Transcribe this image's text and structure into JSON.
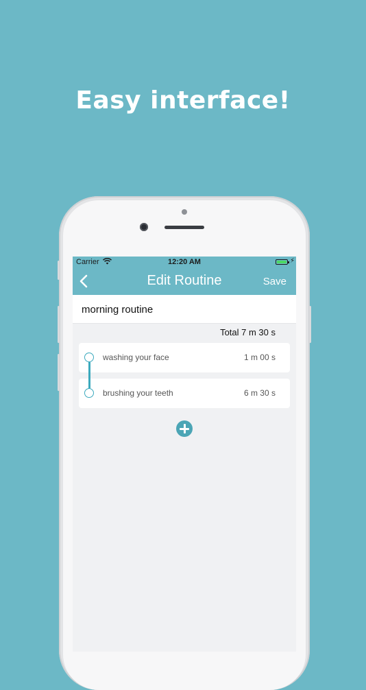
{
  "promo": {
    "headline": "Easy interface!"
  },
  "status_bar": {
    "carrier": "Carrier",
    "time": "12:20 AM",
    "wifi_icon": "wifi-icon",
    "battery_icon": "battery-charging-icon"
  },
  "nav": {
    "back_icon": "chevron-left-icon",
    "title": "Edit Routine",
    "save_label": "Save"
  },
  "routine": {
    "name": "morning routine",
    "total": "Total 7 m 30 s",
    "steps": [
      {
        "name": "washing your face",
        "duration": "1 m 00 s"
      },
      {
        "name": "brushing your teeth",
        "duration": "6 m 30 s"
      }
    ],
    "add_icon": "plus-circle-icon"
  },
  "colors": {
    "background": "#6cb8c6",
    "accent": "#3ba9bd",
    "screen_background": "#f0f1f3"
  }
}
